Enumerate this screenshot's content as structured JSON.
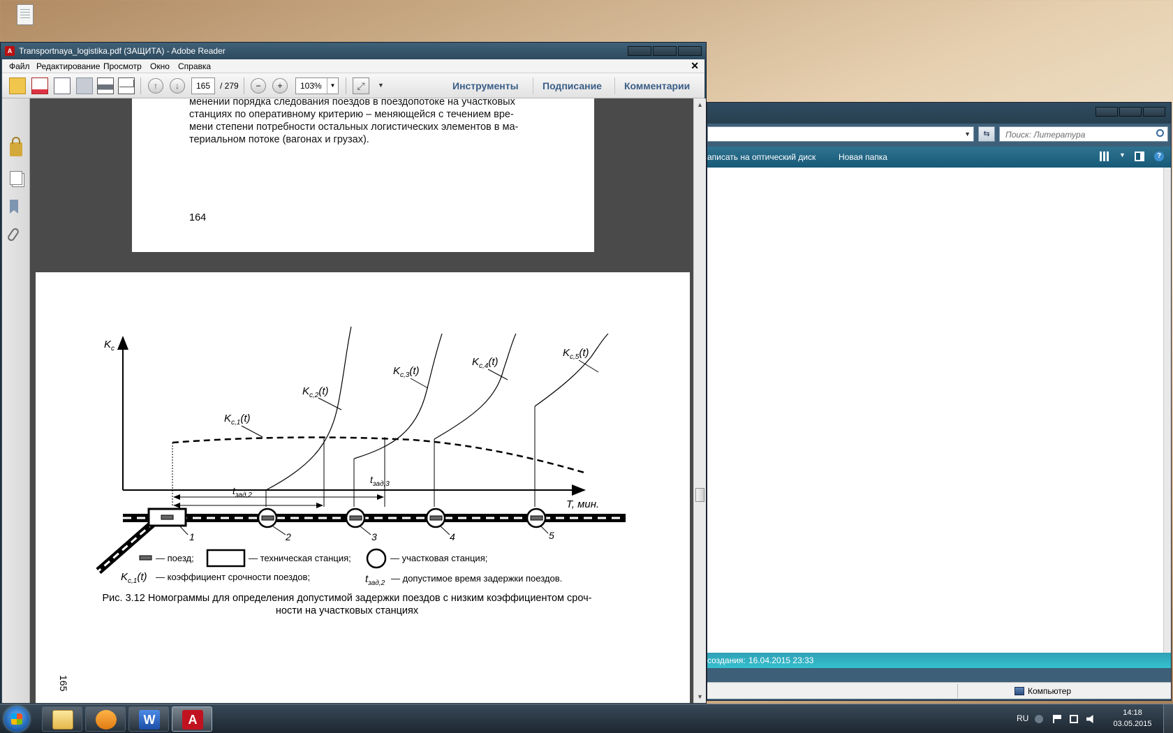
{
  "explorer": {
    "search_placeholder": "Поиск: Литература",
    "cmd_burn": "аписать на оптический диск",
    "cmd_new_folder": "Новая папка",
    "details_label": "создания:",
    "details_value": "16.04.2015 23:33",
    "status_computer": "Компьютер",
    "refresh_icon": "refresh-icon"
  },
  "reader": {
    "title": "Transportnaya_logistika.pdf (ЗАЩИТА) - Adobe Reader",
    "menu": [
      "Файл",
      "Редактирование",
      "Просмотр",
      "Окно",
      "Справка"
    ],
    "close_symbol": "✕",
    "page_current": "165",
    "page_total": "/ 279",
    "zoom": "103%",
    "panel_links": [
      "Инструменты",
      "Подписание",
      "Комментарии"
    ]
  },
  "document": {
    "prev_page_text_lines": [
      "менении порядка следования поездов в поездопотоке на участковых",
      "станциях по оперативному критерию – меняющейся с течением вре-",
      "мени степени потребности остальных логистических элементов в ма-",
      "териальном потоке (вагонах и грузах)."
    ],
    "prev_page_number": "164",
    "side_page_number": "165",
    "figure": {
      "y_axis_label": "K",
      "y_axis_sub": "c",
      "x_axis_label": "T, мин.",
      "curves": [
        {
          "label": "K",
          "sub": "c,1",
          "arg": "(t)"
        },
        {
          "label": "K",
          "sub": "c,2",
          "arg": "(t)"
        },
        {
          "label": "K",
          "sub": "c,3",
          "arg": "(t)"
        },
        {
          "label": "K",
          "sub": "c,4",
          "arg": "(t)"
        },
        {
          "label": "K",
          "sub": "c,5",
          "arg": "(t)"
        }
      ],
      "delay_labels": [
        {
          "label": "t",
          "sub": "зад,2"
        },
        {
          "label": "t",
          "sub": "зад,3"
        }
      ],
      "stations": [
        "1",
        "2",
        "3",
        "4",
        "5"
      ],
      "legend": {
        "train": "— поезд;",
        "tech_station": "— техническая станция;",
        "section_station": "— участковая станция;",
        "coef_sym": "K",
        "coef_sub": "c,1",
        "coef_arg": "(t)",
        "coef_text": "— коэффициент срочности поездов;",
        "delay_sym": "t",
        "delay_sub": "зад,2",
        "delay_text": "— допустимое время задержки поездов."
      },
      "caption_line1": "Рис. 3.12 Номограммы для определения допустимой задержки поездов с низким коэффициентом сроч-",
      "caption_line2": "ности на участковых станциях"
    }
  },
  "taskbar": {
    "language": "RU",
    "time": "14:18",
    "date": "03.05.2015",
    "word_glyph": "W",
    "acrobat_glyph": "A"
  }
}
